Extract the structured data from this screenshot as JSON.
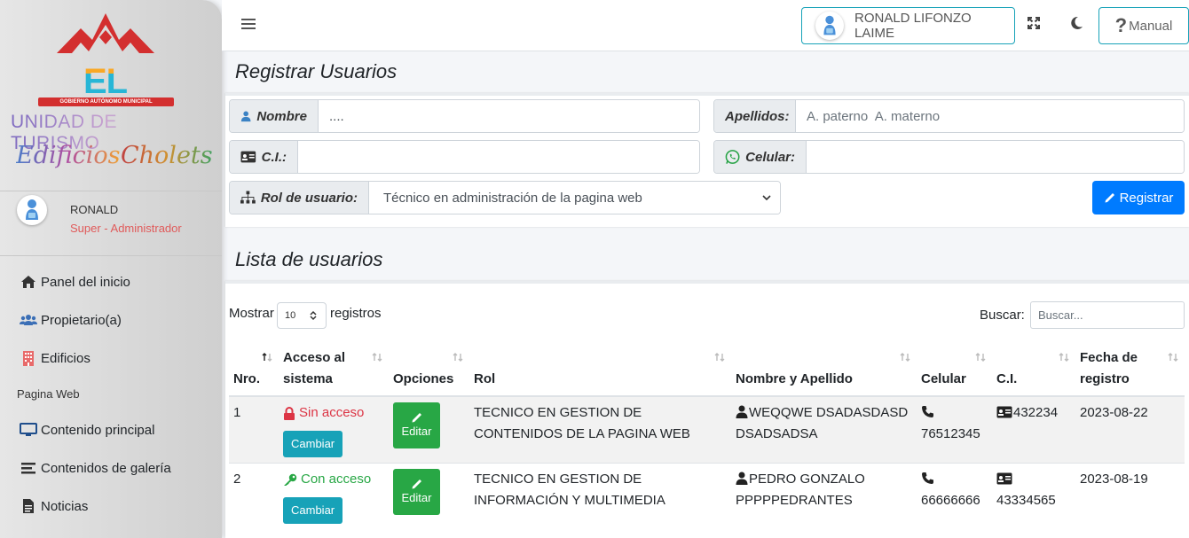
{
  "brand": {
    "city_name": "EL ALTO",
    "city_subtitle": "GOBIERNO AUTÓNOMO MUNICIPAL",
    "unit": "UNIDAD DE TURISMO",
    "script_left": "Edificios",
    "script_right": "Cholets"
  },
  "sidebar_user": {
    "name": "RONALD",
    "role": "Super - Administrador"
  },
  "sidebar": {
    "items": [
      {
        "label": "Panel del inicio",
        "icon": "home-icon"
      },
      {
        "label": "Propietario(a)",
        "icon": "users-icon"
      },
      {
        "label": "Edificios",
        "icon": "building-icon"
      }
    ],
    "header": "Pagina Web",
    "web_items": [
      {
        "label": "Contenido principal",
        "icon": "desktop-icon"
      },
      {
        "label": "Contenidos de galería",
        "icon": "list-icon"
      },
      {
        "label": "Noticias",
        "icon": "document-icon"
      }
    ]
  },
  "navbar": {
    "user_button": "RONALD LIFONZO LAIME",
    "manual": "Manual"
  },
  "form": {
    "title": "Registrar Usuarios",
    "nombre_label": "Nombre",
    "nombre_value": "....",
    "apellidos_label": "Apellidos:",
    "apellidos_placeholder": "A. paterno  A. materno",
    "ci_label": "C.I.:",
    "celular_label": "Celular:",
    "rol_label": "Rol de usuario:",
    "rol_value": "Técnico en administración de la pagina web",
    "submit": "Registrar"
  },
  "list": {
    "title": "Lista de usuarios",
    "show_label": "Mostrar",
    "show_value": "10",
    "records_label": "registros",
    "search_label": "Buscar:",
    "search_placeholder": "Buscar...",
    "headers": {
      "nro": "Nro.",
      "acceso_1": "Acceso al",
      "acceso_2": "sistema",
      "opciones": "Opciones",
      "rol": "Rol",
      "nombre": "Nombre y Apellido",
      "celular": "Celular",
      "ci": "C.I.",
      "fecha_1": "Fecha de",
      "fecha_2": "registro"
    },
    "edit_label": "Editar",
    "change_label": "Cambiar",
    "rows": [
      {
        "nro": "1",
        "acceso": "Sin acceso",
        "rol": "TECNICO EN GESTION DE CONTENIDOS DE LA PAGINA WEB",
        "nombre": "WEQQWE DSADASDASD DSADSADSA",
        "celular": "76512345",
        "ci": "432234",
        "fecha": "2023-08-22"
      },
      {
        "nro": "2",
        "acceso": "Con acceso",
        "rol": "TECNICO EN GESTION DE INFORMACIÓN Y MULTIMEDIA",
        "nombre": "PEDRO GONZALO PPPPPEDRANTES",
        "celular": "66666666",
        "ci": "43334565",
        "fecha": "2023-08-19"
      }
    ]
  },
  "colors": {
    "primary": "#007bff",
    "info": "#17a2b8",
    "success": "#28a745",
    "danger": "#dc3545"
  }
}
